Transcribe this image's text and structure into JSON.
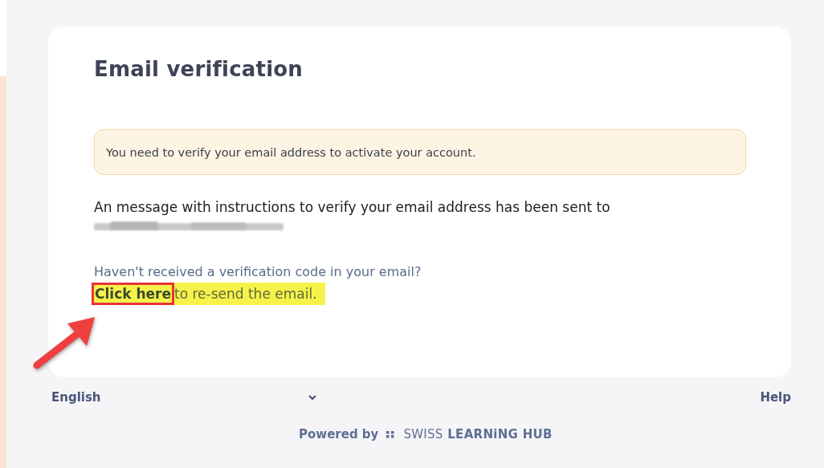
{
  "card": {
    "title": "Email verification",
    "alert": "You need to verify your email address to activate your account.",
    "message": "An message with instructions to verify your email address has been sent to",
    "question": "Haven't received a verification code in your email?",
    "resend": {
      "link": "Click here",
      "rest": "to re-send the email."
    }
  },
  "footer": {
    "language": "English",
    "help": "Help",
    "powered_by": "Powered by",
    "brand_light": "SWISS",
    "brand_bold": "LEARNiNG HUB"
  }
}
